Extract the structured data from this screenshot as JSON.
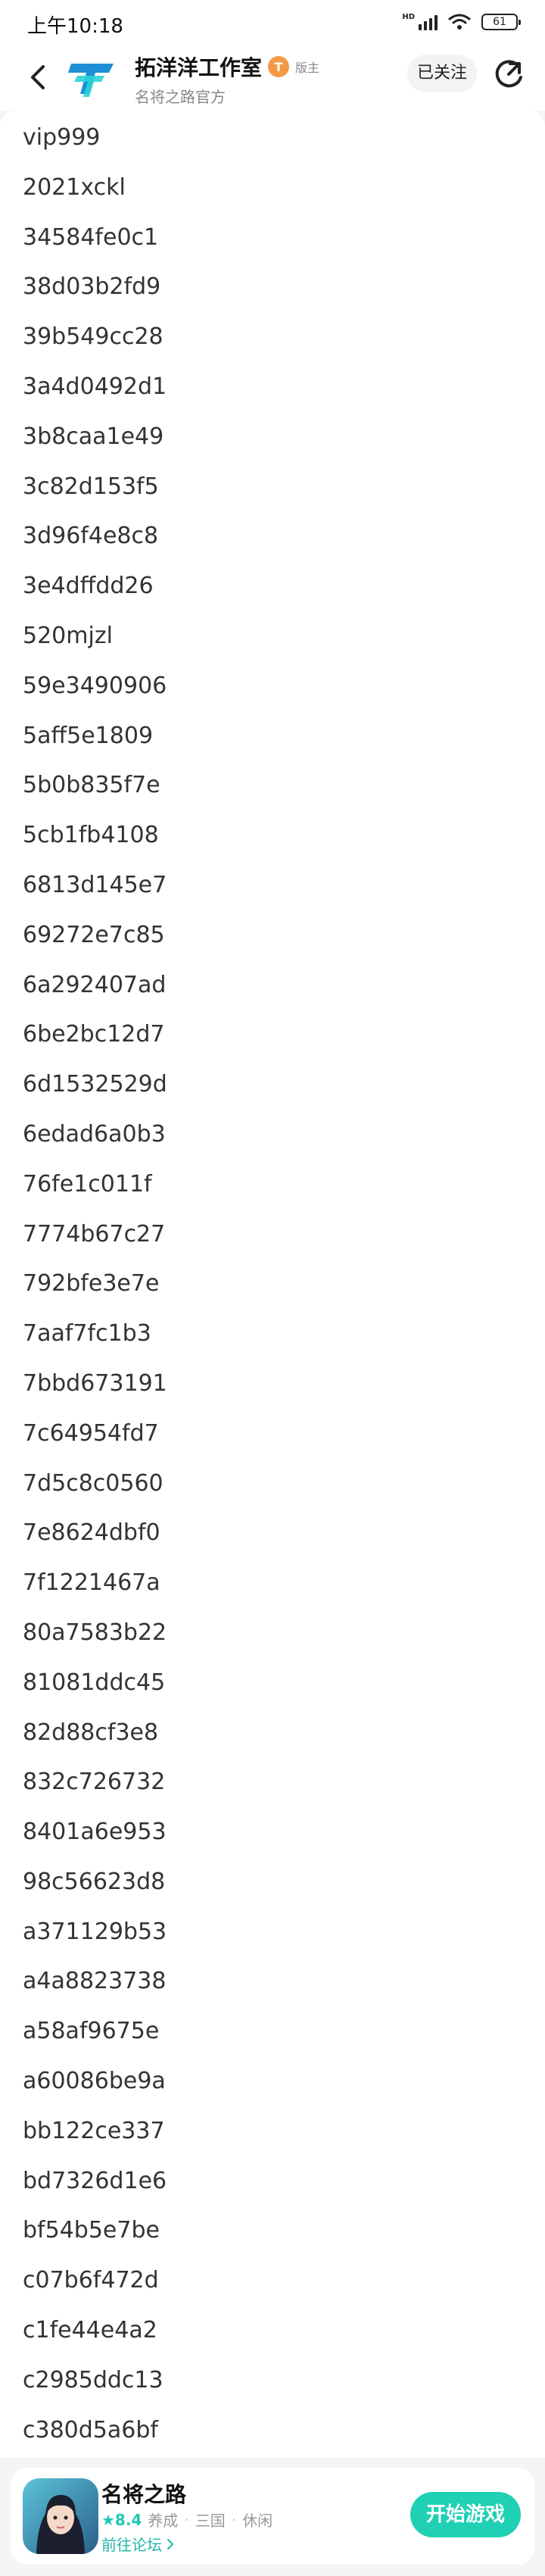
{
  "status_bar": {
    "time": "上午10:18",
    "battery": "61"
  },
  "header": {
    "studio_name": "拓洋洋工作室",
    "owner_badge": "T",
    "owner_label": "版主",
    "subtitle": "名将之路官方",
    "follow_label": "已关注"
  },
  "codes": [
    "vip999",
    "2021xckl",
    "34584fe0c1",
    "38d03b2fd9",
    "39b549cc28",
    "3a4d0492d1",
    "3b8caa1e49",
    "3c82d153f5",
    "3d96f4e8c8",
    "3e4dffdd26",
    "520mjzl",
    "59e3490906",
    "5aff5e1809",
    "5b0b835f7e",
    "5cb1fb4108",
    "6813d145e7",
    "69272e7c85",
    "6a292407ad",
    "6be2bc12d7",
    "6d1532529d",
    "6edad6a0b3",
    "76fe1c011f",
    "7774b67c27",
    "792bfe3e7e",
    "7aaf7fc1b3",
    "7bbd673191",
    "7c64954fd7",
    "7d5c8c0560",
    "7e8624dbf0",
    "7f1221467a",
    "80a7583b22",
    "81081ddc45",
    "82d88cf3e8",
    "832c726732",
    "8401a6e953",
    "98c56623d8",
    "a371129b53",
    "a4a8823738",
    "a58af9675e",
    "a60086be9a",
    "bb122ce337",
    "bd7326d1e6",
    "bf54b5e7be",
    "c07b6f472d",
    "c1fe44e4a2",
    "c2985ddc13",
    "c380d5a6bf"
  ],
  "game_card": {
    "name": "名将之路",
    "rating": "★8.4",
    "tags": [
      "养成",
      "三国",
      "休闲"
    ],
    "forum_link": "前往论坛",
    "play_label": "开始游戏"
  },
  "colors": {
    "accent": "#1fd0b4",
    "owner_badge": "#f29a45",
    "logo_blue": "#1e90d6",
    "logo_cyan": "#2bd3d8"
  },
  "icons": {
    "back": "chevron-left-icon",
    "share": "share-icon",
    "forum_arrow": "chevron-right-icon",
    "wifi": "wifi-icon",
    "signal": "signal-icon",
    "battery": "battery-icon"
  }
}
